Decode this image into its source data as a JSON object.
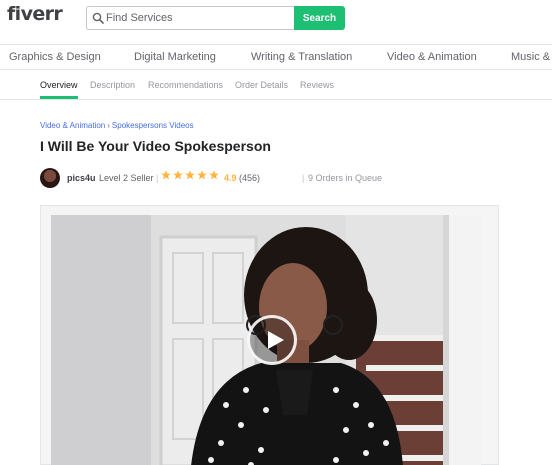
{
  "header": {
    "logo_text": "fiverr",
    "search": {
      "placeholder": "Find Services",
      "value": "",
      "button_label": "Search"
    }
  },
  "categories": [
    "Graphics & Design",
    "Digital Marketing",
    "Writing & Translation",
    "Video & Animation",
    "Music & Au"
  ],
  "tabs": [
    {
      "label": "Overview",
      "active": true
    },
    {
      "label": "Description",
      "active": false
    },
    {
      "label": "Recommendations",
      "active": false
    },
    {
      "label": "Order Details",
      "active": false
    },
    {
      "label": "Reviews",
      "active": false
    }
  ],
  "breadcrumb": {
    "items": [
      "Video & Animation",
      "Spokespersons Videos"
    ],
    "separator": "›"
  },
  "gig": {
    "title": "I Will Be Your Video Spokesperson",
    "seller": {
      "name": "pics4u",
      "level": "Level 2 Seller",
      "rating_value": "4.9",
      "star_count": 5,
      "review_count": "(456)",
      "orders_in_queue": "9 Orders in Queue"
    }
  },
  "video": {
    "play_icon": "play-icon"
  },
  "colors": {
    "brand_green": "#1dbf73",
    "star_yellow": "#ffb33e",
    "link_blue": "#446ee7",
    "text_dark": "#222325",
    "text_muted": "#62646a"
  }
}
